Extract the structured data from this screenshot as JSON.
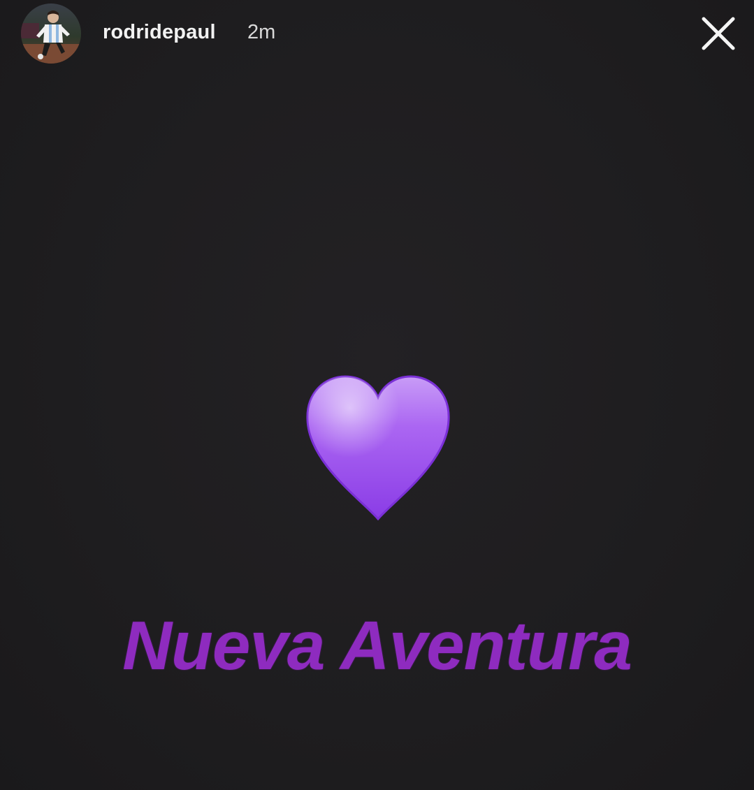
{
  "story": {
    "username": "rodridepaul",
    "timestamp": "2m",
    "caption": "Nueva Aventura"
  },
  "icons": {
    "avatar": "profile-photo-soccer-player",
    "close": "close-icon",
    "sticker": "purple-heart-emoji"
  },
  "colors": {
    "background": "#1e1d1f",
    "caption": "#8e2bbf",
    "heart": "#a55df0",
    "header_text": "#f2f2f2"
  }
}
